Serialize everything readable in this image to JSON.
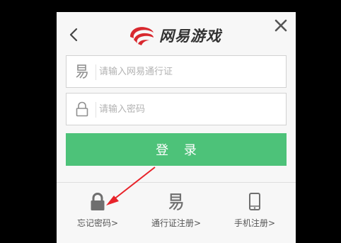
{
  "logo": {
    "text": "网易游戏"
  },
  "account_field": {
    "placeholder": "请输入网易通行证",
    "icon": "netease-yi-icon"
  },
  "password_field": {
    "placeholder": "请输入密码",
    "icon": "lock-outline-icon"
  },
  "login_button": {
    "label": "登 录",
    "color": "#4dc279"
  },
  "bottom_links": [
    {
      "label": "忘记密码>",
      "icon": "lock-icon"
    },
    {
      "label": "通行证注册>",
      "icon": "netease-yi-icon"
    },
    {
      "label": "手机注册>",
      "icon": "phone-icon"
    }
  ],
  "colors": {
    "brand_red": "#d8282e",
    "annotation_red": "#e8232a",
    "background": "#000000"
  }
}
